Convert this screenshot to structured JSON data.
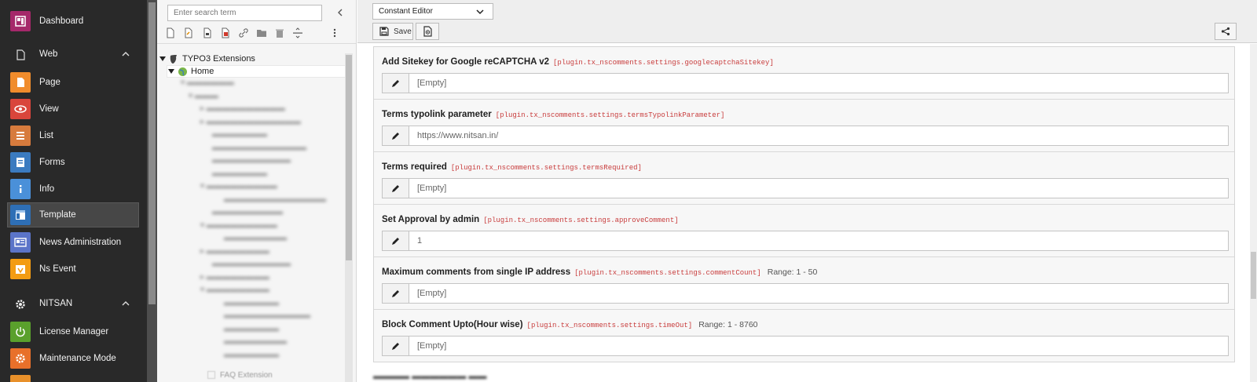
{
  "module_menu": {
    "items": [
      {
        "label": "Dashboard",
        "icon": "dashboard-icon",
        "color": "#a5286a"
      },
      {
        "label": "Page",
        "icon": "page-icon",
        "color": "#f08c2c"
      },
      {
        "label": "View",
        "icon": "eye-icon",
        "color": "#d9453b"
      },
      {
        "label": "List",
        "icon": "list-icon",
        "color": "#d77b3d"
      },
      {
        "label": "Forms",
        "icon": "forms-icon",
        "color": "#3b7bc0"
      },
      {
        "label": "Info",
        "icon": "info-icon",
        "color": "#4a90d9"
      },
      {
        "label": "Template",
        "icon": "template-icon",
        "color": "#2e6fb6"
      },
      {
        "label": "News Administration",
        "icon": "news-icon",
        "color": "#5b74c8"
      },
      {
        "label": "Ns Event",
        "icon": "calendar-icon",
        "color": "#f39c12"
      },
      {
        "label": "License Manager",
        "icon": "power-icon",
        "color": "#5aa02c"
      },
      {
        "label": "Maintenance Mode",
        "icon": "settings-icon",
        "color": "#e8702a"
      }
    ],
    "groups": [
      {
        "label": "Web",
        "icon": "file-icon"
      },
      {
        "label": "NITSAN",
        "icon": "gear-icon"
      }
    ],
    "active": "Template"
  },
  "tree": {
    "search_placeholder": "Enter search term",
    "root_label": "TYPO3 Extensions",
    "home_label": "Home",
    "last_label": "FAQ Extension"
  },
  "toolbar": {
    "select_value": "Constant Editor",
    "save_label": "Save"
  },
  "constants": [
    {
      "title": "Add Sitekey for Google reCAPTCHA v2",
      "key": "[plugin.tx_nscomments.settings.googlecaptchaSitekey]",
      "range": "",
      "value": "[Empty]"
    },
    {
      "title": "Terms typolink parameter",
      "key": "[plugin.tx_nscomments.settings.termsTypolinkParameter]",
      "range": "",
      "value": "https://www.nitsan.in/"
    },
    {
      "title": "Terms required",
      "key": "[plugin.tx_nscomments.settings.termsRequired]",
      "range": "",
      "value": "[Empty]"
    },
    {
      "title": "Set Approval by admin",
      "key": "[plugin.tx_nscomments.settings.approveComment]",
      "range": "",
      "value": "1"
    },
    {
      "title": "Maximum comments from single IP address",
      "key": "[plugin.tx_nscomments.settings.commentCount]",
      "range": "Range: 1 - 50",
      "value": "[Empty]"
    },
    {
      "title": "Block Comment Upto(Hour wise)",
      "key": "[plugin.tx_nscomments.settings.timeOut]",
      "range": "Range: 1 - 8760",
      "value": "[Empty]"
    }
  ]
}
